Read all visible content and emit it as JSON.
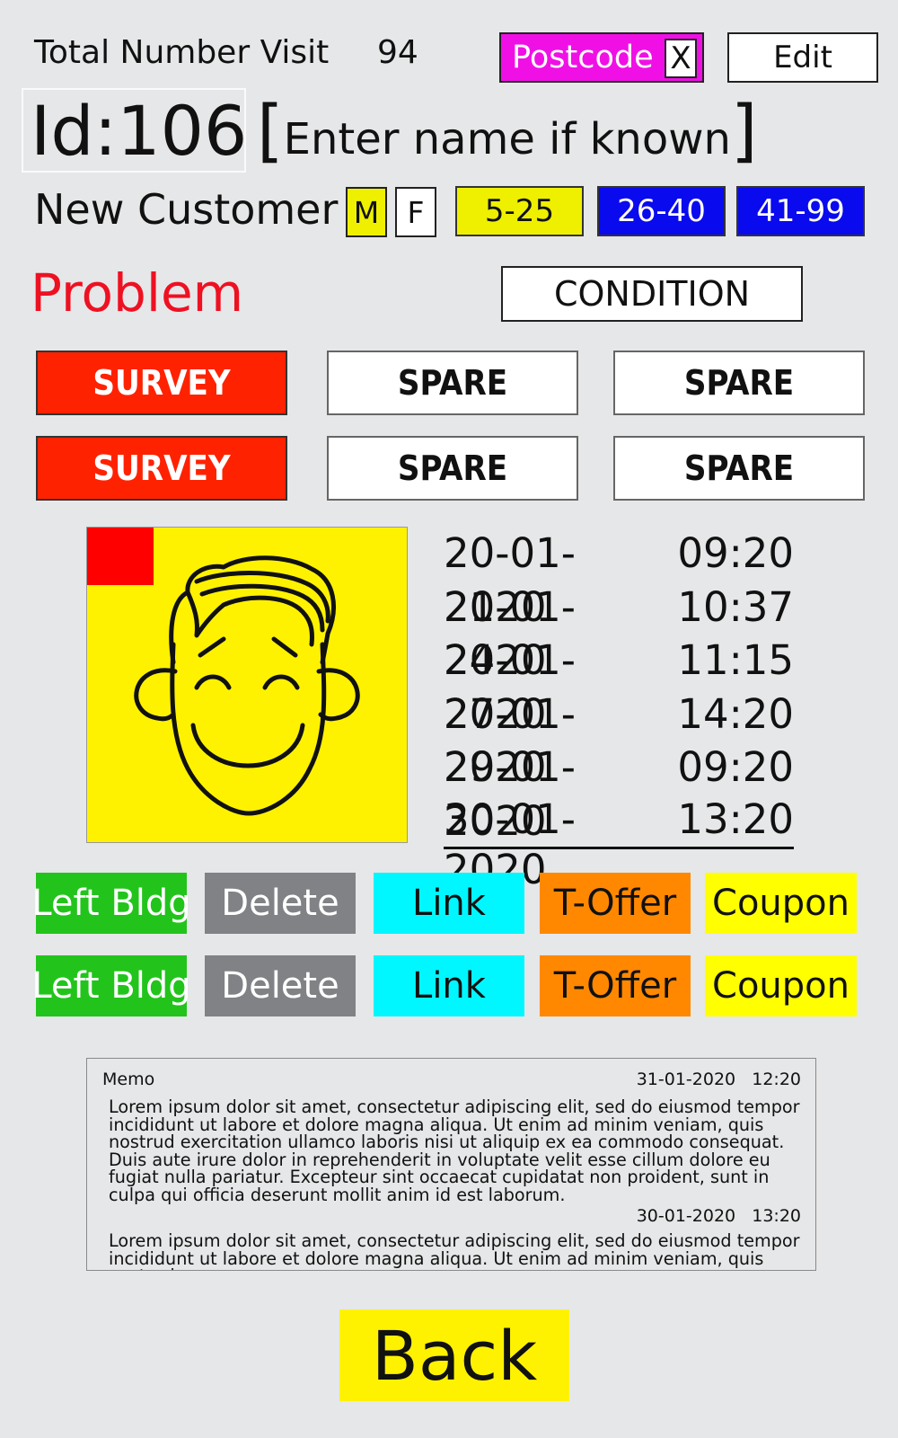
{
  "header": {
    "visit_label": "Total Number Visit",
    "visit_count": "94",
    "postcode_label": "Postcode",
    "postcode_clear": "X",
    "edit_label": "Edit"
  },
  "customer": {
    "id_label": "Id:106",
    "name_placeholder": "Enter name if known",
    "status": "New Customer",
    "sex_options": [
      "M",
      "F"
    ],
    "sex_selected": "M",
    "age_groups": [
      "5-25",
      "26-40",
      "41-99"
    ],
    "age_selected": "5-25"
  },
  "problem": {
    "title": "Problem",
    "condition_label": "CONDITION",
    "buttons": [
      [
        "SURVEY",
        "SPARE",
        "SPARE"
      ],
      [
        "SURVEY",
        "SPARE",
        "SPARE"
      ]
    ]
  },
  "avatar": {
    "icon": "smiling-face-icon",
    "flag_color": "#ff0000",
    "background_color": "#fff200"
  },
  "visits": [
    {
      "date": "20-01-2020",
      "time": "09:20"
    },
    {
      "date": "21-01-2020",
      "time": "10:37"
    },
    {
      "date": "24-01-2020",
      "time": "11:15"
    },
    {
      "date": "27-01-2020",
      "time": "14:20"
    },
    {
      "date": "29-01-2020",
      "time": "09:20"
    },
    {
      "date": "30-01-2020",
      "time": "13:20"
    }
  ],
  "actions": [
    [
      "Left Bldg",
      "Delete",
      "Link",
      "T-Offer",
      "Coupon"
    ],
    [
      "Left Bldg",
      "Delete",
      "Link",
      "T-Offer",
      "Coupon"
    ]
  ],
  "memo": {
    "label": "Memo",
    "entries": [
      {
        "date": "31-01-2020   12:20",
        "text": "Lorem ipsum dolor sit amet, consectetur adipiscing elit, sed do eiusmod tempor incididunt ut labore et dolore magna aliqua. Ut enim ad minim veniam, quis nostrud exercitation ullamco laboris nisi ut aliquip ex ea commodo consequat. Duis aute irure dolor in reprehenderit in voluptate velit esse cillum dolore eu fugiat nulla pariatur. Excepteur sint occaecat cupidatat non proident, sunt in culpa qui officia deserunt mollit anim id est laborum."
      },
      {
        "date": "30-01-2020   13:20",
        "text": "Lorem ipsum dolor sit amet, consectetur adipiscing elit, sed do eiusmod tempor incididunt ut labore et dolore magna aliqua. Ut enim ad minim veniam, quis nostrud"
      }
    ]
  },
  "back_label": "Back",
  "colors": {
    "background": "#e6e7e8",
    "postcode": "#f010e6",
    "problem_text": "#ee1122",
    "survey": "#ff2200",
    "age_yellow": "#eef000",
    "age_blue": "#0a0aee",
    "left_bldg": "#22c41c",
    "delete": "#808285",
    "link": "#00f7ff",
    "t_offer": "#ff8800",
    "coupon": "#ffff00",
    "back": "#fff200"
  }
}
